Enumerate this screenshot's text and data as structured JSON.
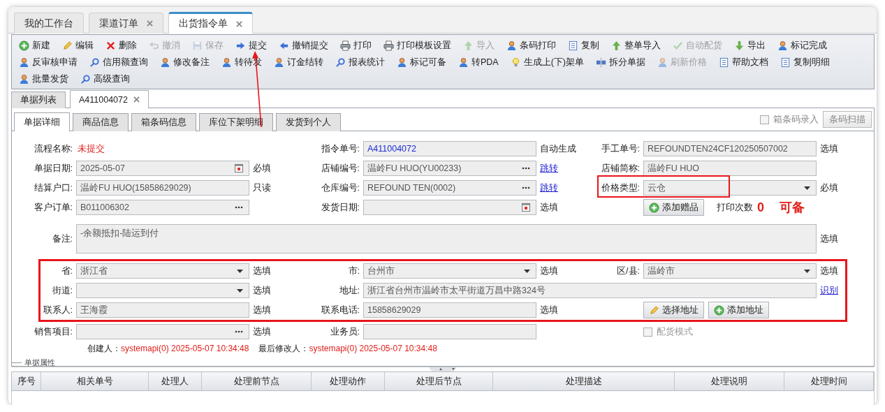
{
  "top_tabs": [
    {
      "label": "我的工作台",
      "closable": false,
      "selected": false
    },
    {
      "label": "渠道订单",
      "closable": true,
      "selected": false
    },
    {
      "label": "出货指令单",
      "closable": true,
      "selected": true
    }
  ],
  "toolbar": {
    "lines": [
      {
        "buttons": [
          {
            "label": "新建",
            "disabled": false
          },
          {
            "label": "编辑",
            "disabled": false
          },
          {
            "label": "删除",
            "disabled": false
          },
          {
            "label": "撤消",
            "disabled": true
          },
          {
            "label": "保存",
            "disabled": true
          },
          {
            "label": "提交",
            "disabled": false
          },
          {
            "label": "撤销提交",
            "disabled": false
          },
          {
            "label": "打印",
            "disabled": false
          },
          {
            "label": "打印模板设置",
            "disabled": false
          },
          {
            "label": "导入",
            "disabled": true
          },
          {
            "label": "条码打印",
            "disabled": false
          },
          {
            "label": "复制",
            "disabled": false
          },
          {
            "label": "整单导入",
            "disabled": false
          },
          {
            "label": "自动配货",
            "disabled": true
          },
          {
            "label": "导出",
            "disabled": false
          },
          {
            "label": "标记完成",
            "disabled": false
          }
        ]
      },
      {
        "buttons": [
          {
            "label": "反审核申请",
            "disabled": false
          },
          {
            "label": "信用额查询",
            "disabled": false
          },
          {
            "label": "修改备注",
            "disabled": false
          },
          {
            "label": "转待发",
            "disabled": false
          },
          {
            "label": "订金结转",
            "disabled": false
          },
          {
            "label": "报表统计",
            "disabled": false
          },
          {
            "label": "标记可备",
            "disabled": false
          },
          {
            "label": "转PDA",
            "disabled": false
          },
          {
            "label": "生成上(下)架单",
            "disabled": false
          },
          {
            "label": "拆分单据",
            "disabled": false
          },
          {
            "label": "刷新价格",
            "disabled": true
          },
          {
            "label": "帮助文档",
            "disabled": false
          },
          {
            "label": "复制明细",
            "disabled": false
          }
        ]
      },
      {
        "buttons": [
          {
            "label": "批量发货",
            "disabled": false
          },
          {
            "label": "高级查询",
            "disabled": false
          }
        ]
      }
    ]
  },
  "doc_tabs": [
    {
      "label": "单据列表",
      "closable": false,
      "selected": false
    },
    {
      "label": "A411004072",
      "closable": true,
      "selected": true
    }
  ],
  "detail_tabs": [
    {
      "label": "单据详细",
      "selected": true
    },
    {
      "label": "商品信息",
      "selected": false
    },
    {
      "label": "箱条码信息",
      "selected": false
    },
    {
      "label": "库位下架明细",
      "selected": false
    },
    {
      "label": "发货到个人",
      "selected": false
    }
  ],
  "barcode_entry": {
    "label": "箱条码录入",
    "checked": false,
    "disabled": true
  },
  "scan_button": {
    "label": "条码扫描",
    "disabled": true
  },
  "form": {
    "rows": [
      {
        "cells": [
          {
            "kind": "status",
            "label": "流程名称:",
            "value": "未提交"
          },
          {
            "kind": "text",
            "label": "指令单号:",
            "value": "A411004072",
            "highlight": true,
            "suffix": {
              "kind": "note",
              "text": "自动生成"
            }
          },
          {
            "kind": "text",
            "label": "手工单号:",
            "value": "REFOUNDTEN24CF120250507002",
            "suffix": {
              "kind": "note",
              "text": "选填"
            }
          }
        ]
      },
      {
        "cells": [
          {
            "kind": "date",
            "label": "单据日期:",
            "value": "2025-05-07",
            "suffix": {
              "kind": "note",
              "text": "必填"
            }
          },
          {
            "kind": "lookup",
            "label": "店铺编号:",
            "value": "温岭FU HUO(YU00233)",
            "suffix": {
              "kind": "link",
              "text": "跳转"
            }
          },
          {
            "kind": "text",
            "label": "店铺简称:",
            "value": "温岭FU HUO"
          }
        ]
      },
      {
        "cells": [
          {
            "kind": "text",
            "label": "结算户口:",
            "value": "温岭FU HUO(15858629029)",
            "suffix": {
              "kind": "note",
              "text": "只读"
            }
          },
          {
            "kind": "lookup",
            "label": "仓库编号:",
            "value": "REFOUND TEN(0002)",
            "suffix": {
              "kind": "link",
              "text": "跳转"
            }
          },
          {
            "kind": "select",
            "label": "价格类型:",
            "value": "云仓",
            "annotated": true,
            "suffix": {
              "kind": "note",
              "text": "必填"
            }
          }
        ]
      },
      {
        "cells": [
          {
            "kind": "lookup",
            "label": "客户订单:",
            "value": "B011006302"
          },
          {
            "kind": "date",
            "label": "发货日期:",
            "suffix": {
              "kind": "note",
              "text": "选填"
            }
          },
          {
            "kind": "actions",
            "button": {
              "label": "添加赠品"
            },
            "print_label": "打印次数",
            "print_count": "0",
            "note": "可备"
          }
        ]
      },
      {
        "cells": [
          {
            "kind": "textarea",
            "label": "备注:",
            "value": "-余额抵扣-陆运到付",
            "suffix": {
              "kind": "note",
              "text": "选填"
            }
          }
        ]
      }
    ],
    "address_block": {
      "annotated": true,
      "rows": [
        {
          "cells": [
            {
              "kind": "select",
              "label": "省:",
              "value": "浙江省",
              "suffix": {
                "kind": "note",
                "text": "选填"
              }
            },
            {
              "kind": "select",
              "label": "市:",
              "value": "台州市",
              "suffix": {
                "kind": "note",
                "text": "选填"
              }
            },
            {
              "kind": "select",
              "label": "区/县:",
              "value": "温岭市",
              "suffix": {
                "kind": "note",
                "text": "选填"
              }
            }
          ]
        },
        {
          "cells": [
            {
              "kind": "select",
              "label": "街道:",
              "suffix": {
                "kind": "note",
                "text": "选填"
              }
            },
            {
              "kind": "wide",
              "label": "地址:",
              "value": "浙江省台州市温岭市太平街道万昌中路324号",
              "suffix": {
                "kind": "link",
                "text": "识别"
              }
            }
          ]
        },
        {
          "cells": [
            {
              "kind": "text",
              "label": "联系人:",
              "value": "王海霞",
              "suffix": {
                "kind": "note",
                "text": "选填"
              }
            },
            {
              "kind": "text",
              "label": "联系电话:",
              "value": "15858629029",
              "suffix": {
                "kind": "note",
                "text": "选填"
              }
            },
            {
              "kind": "buttons",
              "buttons": [
                {
                  "label": "选择地址"
                },
                {
                  "label": "添加地址"
                }
              ]
            }
          ]
        }
      ]
    },
    "more_rows": [
      {
        "cells": [
          {
            "kind": "lookup",
            "label": "销售项目:",
            "suffix": {
              "kind": "note",
              "text": "选填"
            }
          },
          {
            "kind": "text",
            "label": "业务员:"
          },
          {
            "kind": "checkbox",
            "label": "配货模式",
            "checked": false,
            "disabled": true
          }
        ]
      }
    ],
    "audit": {
      "created_label": "创建人：",
      "created_value": "systemapi(0) 2025-05-07 10:34:48",
      "modified_label": "最后修改人：",
      "modified_value": "systemapi(0) 2025-05-07 10:34:48"
    },
    "section_title": "单据属性"
  },
  "history_table": {
    "columns": [
      "序号",
      "相关单号",
      "处理人",
      "处理前节点",
      "处理动作",
      "处理后节点",
      "处理描述",
      "处理说明",
      "处理时间"
    ]
  }
}
